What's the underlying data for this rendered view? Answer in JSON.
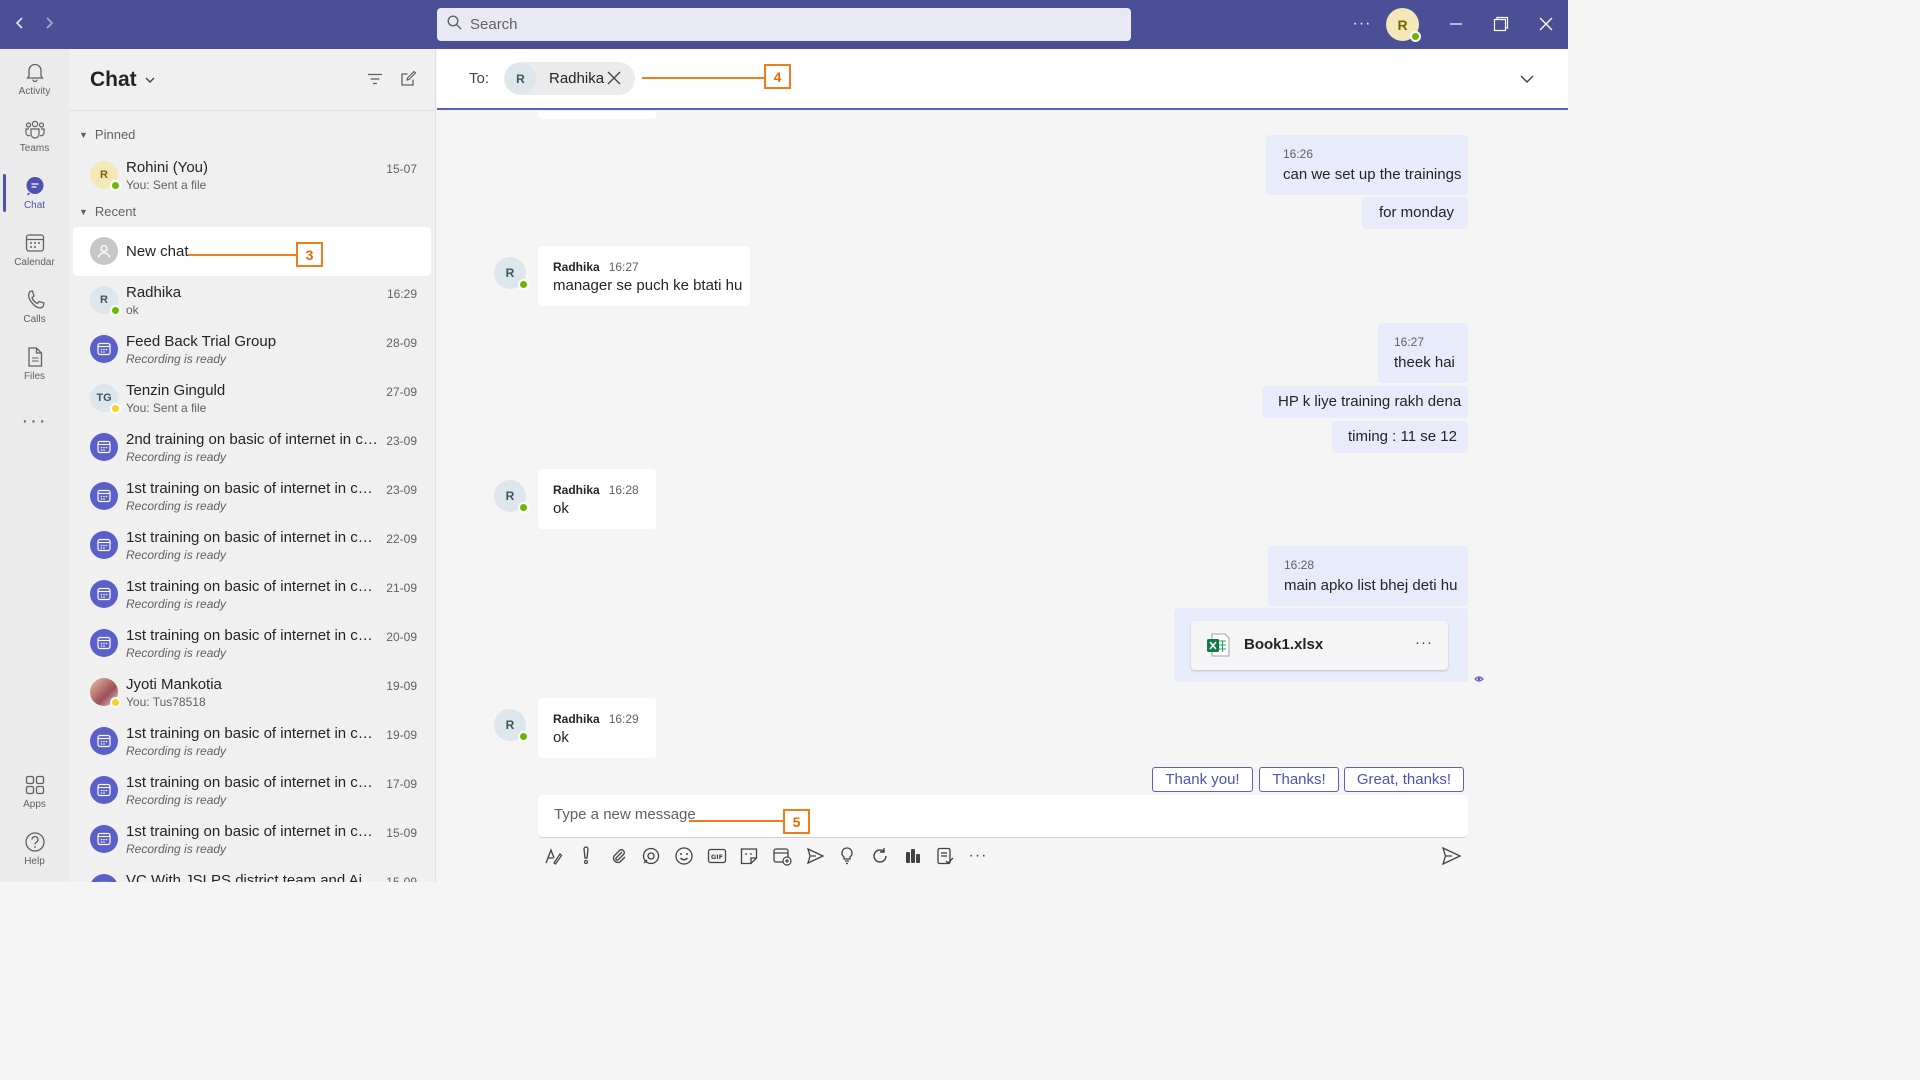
{
  "titlebar": {
    "search_placeholder": "Search",
    "more_label": "···",
    "user_initial": "R"
  },
  "rail": {
    "items": [
      {
        "label": "Activity",
        "icon": "bell-icon"
      },
      {
        "label": "Teams",
        "icon": "teams-icon"
      },
      {
        "label": "Chat",
        "icon": "chat-icon"
      },
      {
        "label": "Calendar",
        "icon": "calendar-icon"
      },
      {
        "label": "Calls",
        "icon": "phone-icon"
      },
      {
        "label": "Files",
        "icon": "file-icon"
      },
      {
        "label": "Apps",
        "icon": "apps-icon"
      },
      {
        "label": "Help",
        "icon": "help-icon"
      }
    ]
  },
  "chatlist": {
    "title": "Chat",
    "pinned_label": "Pinned",
    "recent_label": "Recent",
    "pinned": [
      {
        "initials": "R",
        "name": "Rohini (You)",
        "preview": "You: Sent a file",
        "time": "15-07"
      }
    ],
    "new_chat_label": "New chat",
    "recent": [
      {
        "initials": "R",
        "name": "Radhika",
        "preview": "ok",
        "time": "16:29",
        "kind": "person"
      },
      {
        "initials": "",
        "name": "Feed Back Trial Group",
        "preview": "Recording is ready",
        "time": "28-09",
        "kind": "meeting"
      },
      {
        "initials": "TG",
        "name": "Tenzin Ginguld",
        "preview": "You: Sent a file",
        "time": "27-09",
        "kind": "person-away"
      },
      {
        "initials": "",
        "name": "2nd training on basic of internet in co...",
        "preview": "Recording is ready",
        "time": "23-09",
        "kind": "meeting"
      },
      {
        "initials": "",
        "name": "1st training on basic of internet in con...",
        "preview": "Recording is ready",
        "time": "23-09",
        "kind": "meeting"
      },
      {
        "initials": "",
        "name": "1st training on basic of internet in con...",
        "preview": "Recording is ready",
        "time": "22-09",
        "kind": "meeting"
      },
      {
        "initials": "",
        "name": "1st training on basic of internet in con...",
        "preview": "Recording is ready",
        "time": "21-09",
        "kind": "meeting"
      },
      {
        "initials": "",
        "name": "1st training on basic of internet in con...",
        "preview": "Recording is ready",
        "time": "20-09",
        "kind": "meeting"
      },
      {
        "initials": "",
        "name": "Jyoti Mankotia",
        "preview": "You: Tus78518",
        "time": "19-09",
        "kind": "photo"
      },
      {
        "initials": "",
        "name": "1st training on basic of internet in con...",
        "preview": "Recording is ready",
        "time": "19-09",
        "kind": "meeting"
      },
      {
        "initials": "",
        "name": "1st training on basic of internet in con...",
        "preview": "Recording is ready",
        "time": "17-09",
        "kind": "meeting"
      },
      {
        "initials": "",
        "name": "1st training on basic of internet in con...",
        "preview": "Recording is ready",
        "time": "15-09",
        "kind": "meeting"
      },
      {
        "initials": "",
        "name": "VC With JSLPS district team and Aiplal...",
        "preview": "",
        "time": "15-09",
        "kind": "meeting"
      }
    ]
  },
  "conversation": {
    "to_label": "To:",
    "recipient": {
      "initial": "R",
      "name": "Radhika"
    },
    "messages": [
      {
        "dir": "out",
        "time": "16:26",
        "text": "can we set up the trainings"
      },
      {
        "dir": "out",
        "text": "for monday"
      },
      {
        "dir": "in",
        "sender": "Radhika",
        "time": "16:27",
        "text": "manager se puch ke btati hu"
      },
      {
        "dir": "out",
        "time": "16:27",
        "text": "theek hai"
      },
      {
        "dir": "out",
        "text": "HP k liye training rakh dena"
      },
      {
        "dir": "out",
        "text": "timing : 11 se 12"
      },
      {
        "dir": "in",
        "sender": "Radhika",
        "time": "16:28",
        "text": "ok"
      },
      {
        "dir": "out",
        "time": "16:28",
        "text": "main apko list bhej deti hu"
      },
      {
        "dir": "in",
        "sender": "Radhika",
        "time": "16:29",
        "text": "ok"
      }
    ],
    "attachment": {
      "name": "Book1.xlsx",
      "icon": "excel-icon",
      "more_label": "···"
    },
    "suggestions": [
      "Thank you!",
      "Thanks!",
      "Great, thanks!"
    ],
    "composer_placeholder": "Type a new message"
  },
  "annotations": {
    "n3": "3",
    "n4": "4",
    "n5": "5"
  },
  "colors": {
    "titlebar": "#4b4f96",
    "brand": "#5b5fc7",
    "annotation": "#f07d19"
  }
}
